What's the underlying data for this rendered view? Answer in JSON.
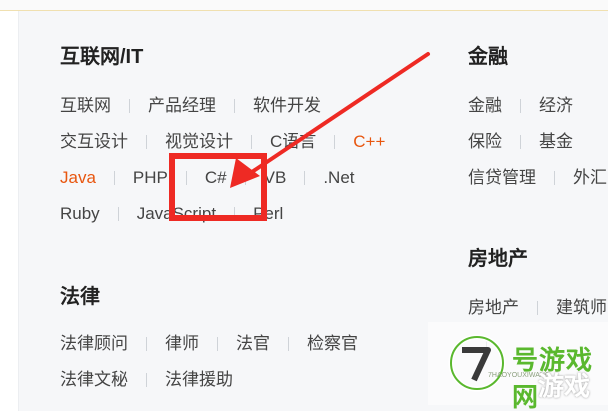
{
  "sections": {
    "internet_it": {
      "title": "互联网/IT",
      "rows": [
        [
          "互联网",
          "产品经理",
          "软件开发"
        ],
        [
          "交互设计",
          "视觉设计",
          "C语言",
          "C++"
        ],
        [
          "Java",
          "PHP",
          "C#",
          "VB",
          ".Net"
        ],
        [
          "Ruby",
          "JavaScript",
          "Perl"
        ]
      ],
      "highlighted": [
        "C++",
        "Java"
      ]
    },
    "finance": {
      "title": "金融",
      "rows": [
        [
          "金融",
          "经济"
        ],
        [
          "保险",
          "基金"
        ],
        [
          "信贷管理",
          "外汇"
        ]
      ]
    },
    "law": {
      "title": "法律",
      "rows": [
        [
          "法律顾问",
          "律师",
          "法官",
          "检察官"
        ],
        [
          "法律文秘",
          "法律援助"
        ]
      ]
    },
    "real_estate": {
      "title": "房地产",
      "rows": [
        [
          "房地产",
          "建筑师"
        ],
        [
          "",
          ""
        ]
      ]
    }
  },
  "annotation": {
    "color": "#ee2a24"
  },
  "watermark": {
    "brand": "号游戏网",
    "sub": "7HAOYOUXIWANG",
    "word2": "游戏"
  },
  "colors": {
    "highlight": "#e8560f",
    "text": "#444444",
    "title": "#222222",
    "panel": "#f6f7f9"
  }
}
